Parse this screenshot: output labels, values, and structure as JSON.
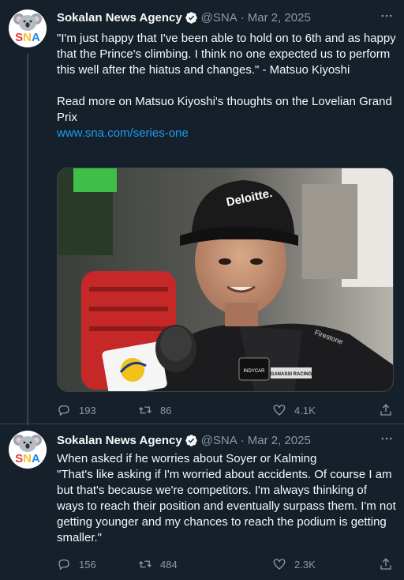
{
  "tweets": [
    {
      "author": {
        "avatar_text": "SNA",
        "name": "Sokalan News Agency",
        "handle": "@SNA",
        "separator": "·",
        "date": "Mar 2, 2025",
        "verified": true
      },
      "text": "\"I'm just happy that I've been able to hold on to 6th and as happy that the Prince's climbing. I think no one expected us to perform this well after the hiatus and changes.\" - Matsuo Kiyoshi\n\nRead more on Matsuo Kiyoshi's thoughts on the Lovelian Grand Prix",
      "link": "www.sna.com/series-one",
      "media": {
        "cap_text": "Deloitte.",
        "suit_brand": "Firestone",
        "patch": "INDYCAR",
        "sponsor": "GANASSI RACING"
      },
      "actions": {
        "replies": "193",
        "retweets": "86",
        "likes": "4.1K"
      }
    },
    {
      "author": {
        "avatar_text": "SNA",
        "name": "Sokalan News Agency",
        "handle": "@SNA",
        "separator": "·",
        "date": "Mar 2, 2025",
        "verified": true
      },
      "text": "When asked if he worries about Soyer or Kalming\n\"That's like asking if I'm worried about accidents. Of course I am but that's because we're competitors. I'm always thinking of ways to reach their position and eventually surpass them. I'm not getting younger and my chances to reach the podium is getting smaller.\"",
      "actions": {
        "replies": "156",
        "retweets": "484",
        "likes": "2.3K"
      }
    }
  ],
  "colors": {
    "background": "#15202b",
    "text": "#f7f9f9",
    "secondary": "#8b98a5",
    "accent": "#1d9bf0",
    "border": "#38444d"
  },
  "icons": [
    "verified-badge-icon",
    "more-options-icon",
    "reply-icon",
    "retweet-icon",
    "like-icon",
    "share-icon"
  ]
}
